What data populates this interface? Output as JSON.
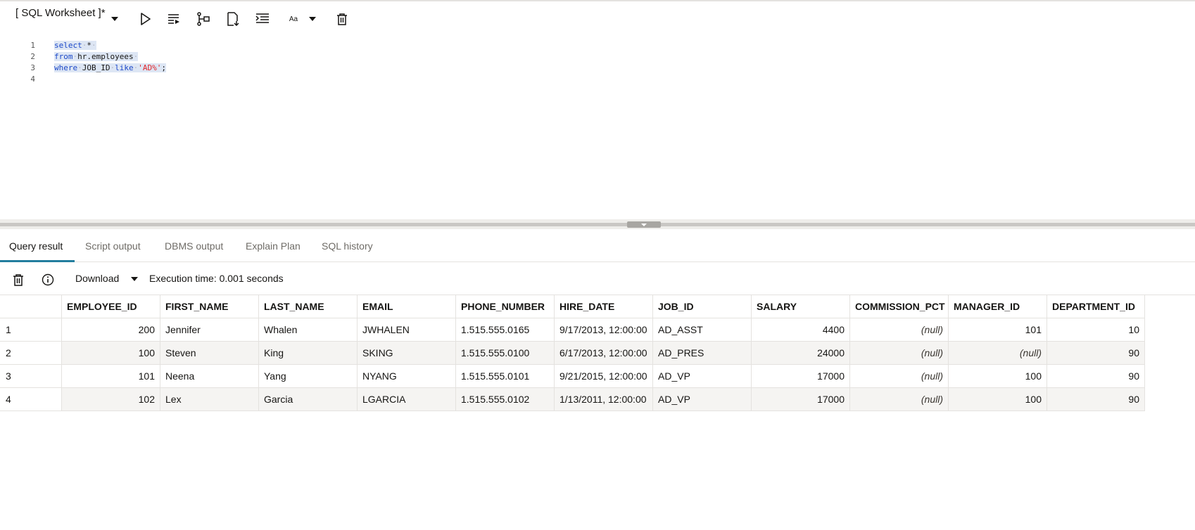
{
  "worksheet": {
    "title": "[ SQL Worksheet ]*"
  },
  "toolbar": {
    "buttons": [
      {
        "name": "run-statement-button",
        "icon": "play-icon"
      },
      {
        "name": "run-script-button",
        "icon": "run-script-icon"
      },
      {
        "name": "explain-plan-button",
        "icon": "explain-plan-icon"
      },
      {
        "name": "save-button",
        "icon": "file-download-icon"
      },
      {
        "name": "format-button",
        "icon": "format-indent-icon"
      },
      {
        "name": "font-size-button",
        "icon": "font-size-icon",
        "label": "Aa"
      },
      {
        "name": "clear-button",
        "icon": "trash-icon"
      }
    ]
  },
  "editor": {
    "lines": [
      {
        "num": "1"
      },
      {
        "num": "2"
      },
      {
        "num": "3"
      },
      {
        "num": "4"
      }
    ],
    "tokens": {
      "l1_kw": "select",
      "l1_rest": "*",
      "l2_kw": "from",
      "l2_rest": "hr.employees",
      "l3_kw1": "where",
      "l3_col": "JOB_ID",
      "l3_kw2": "like",
      "l3_str": "'AD%'",
      "l3_end": ";"
    }
  },
  "tabs": [
    {
      "label": "Query result",
      "active": true
    },
    {
      "label": "Script output",
      "active": false
    },
    {
      "label": "DBMS output",
      "active": false
    },
    {
      "label": "Explain Plan",
      "active": false
    },
    {
      "label": "SQL history",
      "active": false
    }
  ],
  "result_toolbar": {
    "download_label": "Download",
    "execution_time": "Execution time: 0.001 seconds"
  },
  "grid": {
    "columns": [
      "EMPLOYEE_ID",
      "FIRST_NAME",
      "LAST_NAME",
      "EMAIL",
      "PHONE_NUMBER",
      "HIRE_DATE",
      "JOB_ID",
      "SALARY",
      "COMMISSION_PCT",
      "MANAGER_ID",
      "DEPARTMENT_ID"
    ],
    "rows": [
      {
        "n": "1",
        "cells": [
          "200",
          "Jennifer",
          "Whalen",
          "JWHALEN",
          "1.515.555.0165",
          "9/17/2013, 12:00:00",
          "AD_ASST",
          "4400",
          "(null)",
          "101",
          "10"
        ]
      },
      {
        "n": "2",
        "cells": [
          "100",
          "Steven",
          "King",
          "SKING",
          "1.515.555.0100",
          "6/17/2013, 12:00:00",
          "AD_PRES",
          "24000",
          "(null)",
          "(null)",
          "90"
        ]
      },
      {
        "n": "3",
        "cells": [
          "101",
          "Neena",
          "Yang",
          "NYANG",
          "1.515.555.0101",
          "9/21/2015, 12:00:00",
          "AD_VP",
          "17000",
          "(null)",
          "100",
          "90"
        ]
      },
      {
        "n": "4",
        "cells": [
          "102",
          "Lex",
          "Garcia",
          "LGARCIA",
          "1.515.555.0102",
          "1/13/2011, 12:00:00",
          "AD_VP",
          "17000",
          "(null)",
          "100",
          "90"
        ]
      }
    ]
  },
  "colors": {
    "accent": "#227e9e",
    "keyword": "#1d49c9",
    "string": "#e2272a",
    "selection": "#dde6f4"
  }
}
